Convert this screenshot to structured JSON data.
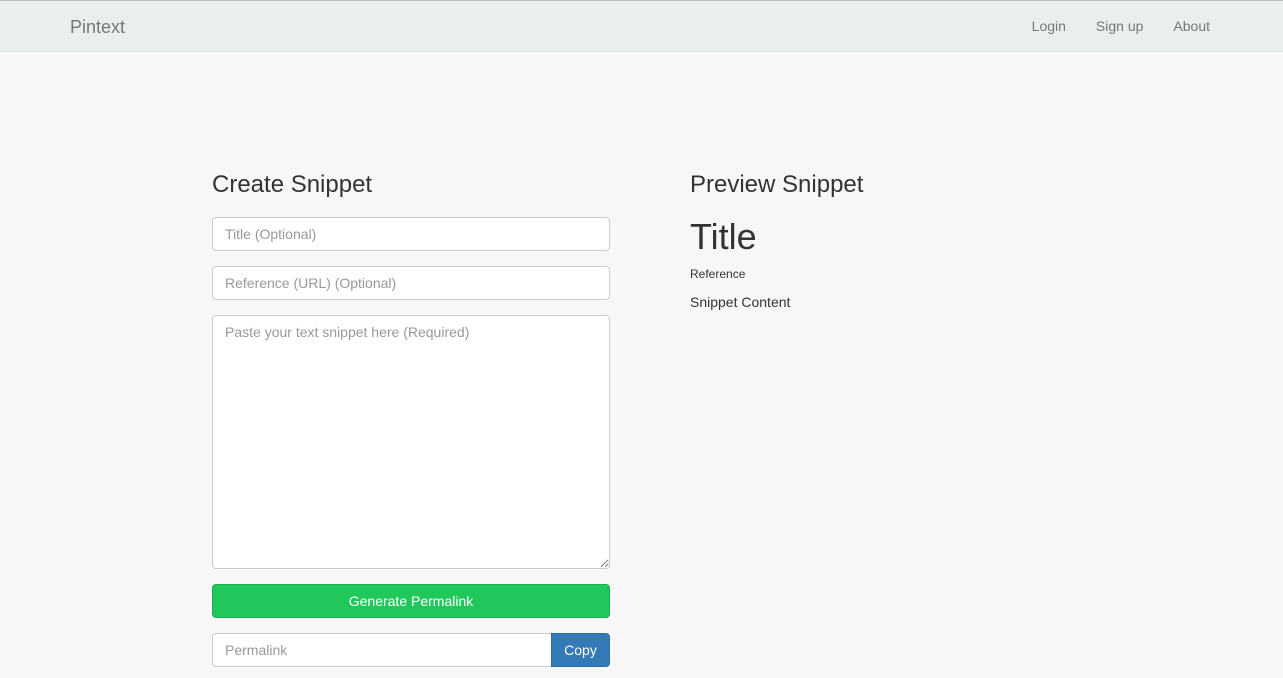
{
  "navbar": {
    "brand": "Pintext",
    "links": [
      "Login",
      "Sign up",
      "About"
    ]
  },
  "create": {
    "heading": "Create Snippet",
    "title_placeholder": "Title (Optional)",
    "reference_placeholder": "Reference (URL) (Optional)",
    "content_placeholder": "Paste your text snippet here (Required)",
    "generate_label": "Generate Permalink",
    "permalink_placeholder": "Permalink",
    "copy_label": "Copy"
  },
  "preview": {
    "heading": "Preview Snippet",
    "title": "Title",
    "reference": "Reference",
    "content": "Snippet Content"
  },
  "colors": {
    "generate_button": "#20c85b",
    "copy_button": "#337ab7",
    "navbar_bg": "#e9eeee",
    "page_bg": "#f7f7f7"
  }
}
